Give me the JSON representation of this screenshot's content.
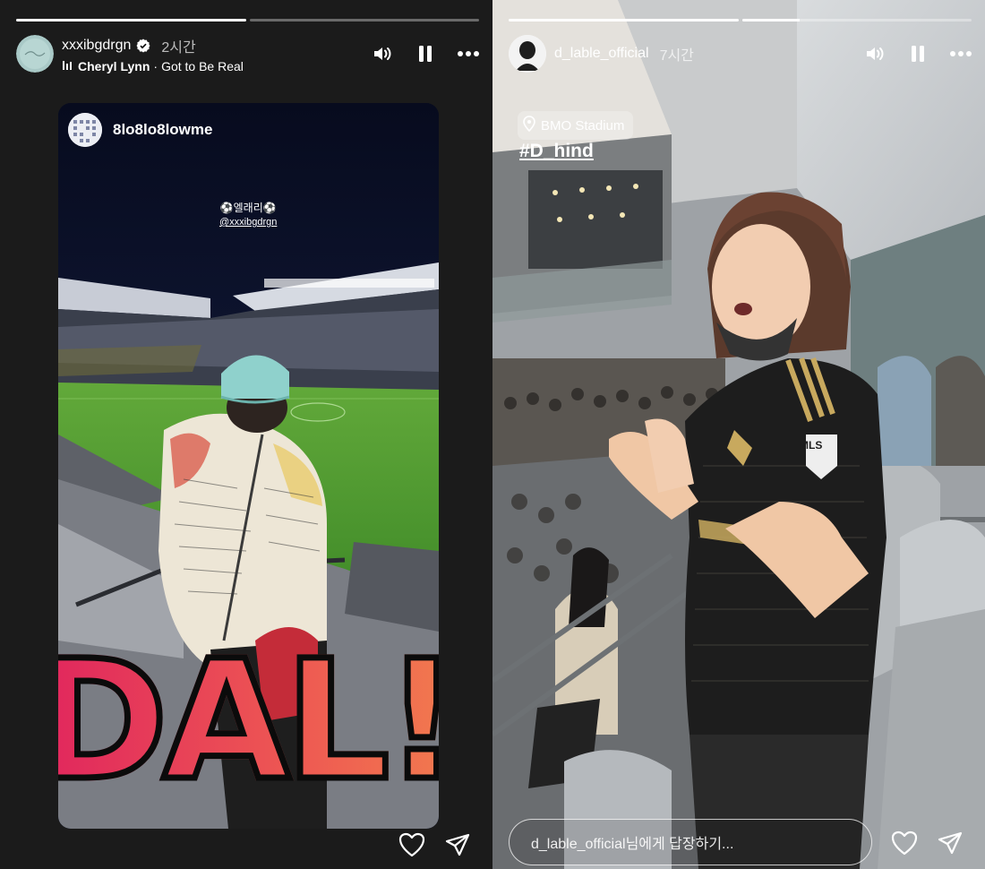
{
  "left_story": {
    "progress": [
      1.0,
      0.0
    ],
    "user": {
      "username": "xxxibgdrgn",
      "verified": true,
      "time_ago": "2시간"
    },
    "music": {
      "artist": "Cheryl Lynn",
      "separator": "·",
      "song": "Got to Be Real"
    },
    "icons": {
      "sound": "speaker-icon",
      "pause": "pause-icon",
      "more": "more-icon",
      "like": "heart-icon",
      "share": "send-icon"
    },
    "shared_post": {
      "username": "8lo8lo8lowme",
      "sticker_title": "⚽엘래리⚽",
      "sticker_mention": "@xxxibgdrgn",
      "overlay_text": "DAL!!"
    }
  },
  "right_story": {
    "progress": [
      1.0,
      0.25
    ],
    "user": {
      "username": "d_lable_official",
      "time_ago": "7시간"
    },
    "location": "BMO Stadium",
    "hashtag": "#D_hind",
    "jersey_text": "MLS",
    "reply_placeholder": "d_lable_official님에게 답장하기...",
    "icons": {
      "sound": "speaker-icon",
      "pause": "pause-icon",
      "more": "more-icon",
      "like": "heart-icon",
      "share": "send-icon",
      "location": "location-pin-icon"
    }
  },
  "colors": {
    "accent_goal_start": "#e0245e",
    "accent_goal_end": "#f3894d",
    "pitch_green": "#4f9a2f",
    "jersey_black": "#1a1a1a",
    "jersey_gold": "#c8a95e"
  }
}
